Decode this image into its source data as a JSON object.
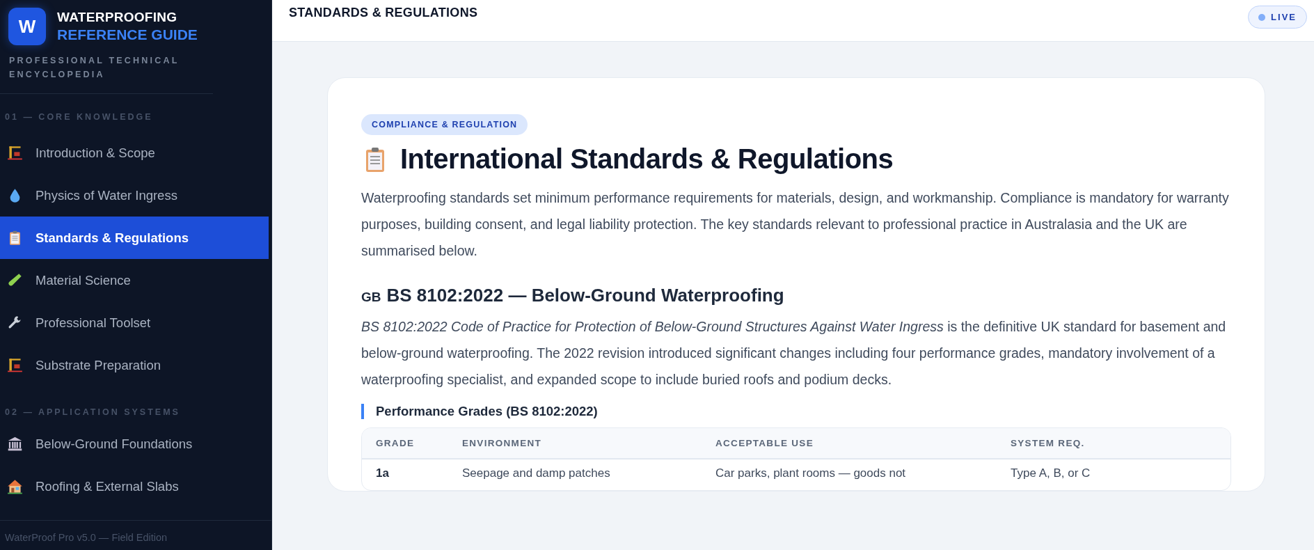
{
  "sidebar": {
    "logo_letter": "W",
    "brand_line_1": "WATERPROOFING",
    "brand_line_2": "REFERENCE GUIDE",
    "tagline": "PROFESSIONAL TECHNICAL ENCYCLOPEDIA",
    "sections": [
      {
        "label": "01 — CORE KNOWLEDGE",
        "items": [
          {
            "label": "Introduction & Scope",
            "selected": false
          },
          {
            "label": "Physics of Water Ingress",
            "selected": false
          },
          {
            "label": "Standards & Regulations",
            "selected": true
          },
          {
            "label": "Material Science",
            "selected": false
          },
          {
            "label": "Professional Toolset",
            "selected": false
          },
          {
            "label": "Substrate Preparation",
            "selected": false
          }
        ]
      },
      {
        "label": "02 — APPLICATION SYSTEMS",
        "items": [
          {
            "label": "Below-Ground Foundations",
            "selected": false
          },
          {
            "label": "Roofing & External Slabs",
            "selected": false
          }
        ]
      }
    ],
    "footer": "WaterProof Pro v5.0 — Field Edition"
  },
  "header": {
    "title": "STANDARDS & REGULATIONS",
    "status": "LIVE"
  },
  "article": {
    "category": "COMPLIANCE & REGULATION",
    "title": "International Standards & Regulations",
    "intro": "Waterproofing standards set minimum performance requirements for materials, design, and workmanship. Compliance is mandatory for warranty purposes, building consent, and legal liability protection. The key standards relevant to professional practice in Australasia and the UK are summarised below.",
    "section": {
      "flag": "GB",
      "title": "BS 8102:2022 — Below-Ground Waterproofing",
      "body": "*BS 8102:2022 Code of Practice for Protection of Below-Ground Structures Against Water Ingress* is the definitive UK standard for basement and below-ground waterproofing. The 2022 revision introduced significant changes including four performance grades, mandatory involvement of a waterproofing specialist, and expanded scope to include buried roofs and podium decks.",
      "subheading": "Performance Grades (BS 8102:2022)",
      "table": {
        "columns": [
          "GRADE",
          "ENVIRONMENT",
          "ACCEPTABLE USE",
          "SYSTEM REQ."
        ],
        "rows": [
          [
            "1a",
            "Seepage and damp patches",
            "Car parks, plant rooms — goods not",
            "Type A, B, or C"
          ]
        ]
      }
    }
  }
}
